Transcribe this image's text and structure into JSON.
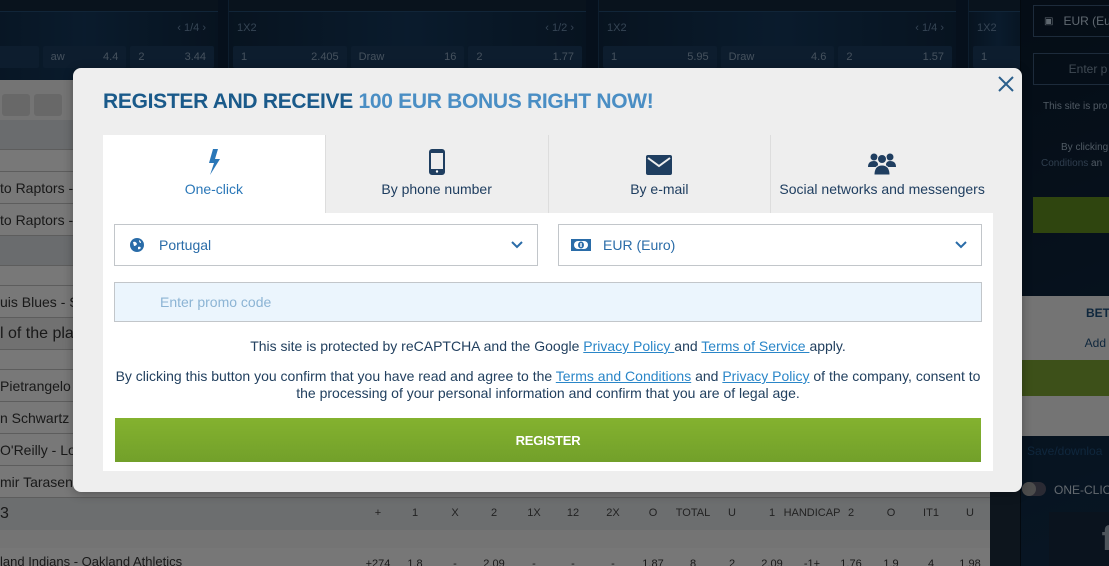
{
  "background": {
    "top_cards": [
      {
        "market": "",
        "pager": "1/4",
        "odds": [
          [
            "aw",
            "4.4"
          ],
          [
            "2",
            "3.44"
          ]
        ]
      },
      {
        "market": "1X2",
        "pager": "1/2",
        "odds": [
          [
            "1",
            "2.405"
          ],
          [
            "Draw",
            "16"
          ],
          [
            "2",
            "1.77"
          ]
        ]
      },
      {
        "market": "1X2",
        "pager": "1/4",
        "odds": [
          [
            "1",
            "5.95"
          ],
          [
            "Draw",
            "4.6"
          ],
          [
            "2",
            "1.57"
          ]
        ]
      },
      {
        "market": "1X2",
        "pager": "",
        "odds": [
          [
            "1",
            ""
          ]
        ]
      }
    ],
    "list_rows": [
      "to Raptors -",
      "to Raptors -",
      "uis Blues - S",
      "l of the pla",
      "Pietrangelo -",
      "n Schwartz -",
      "O'Reilly - Log",
      "mir Tarasenk",
      "3"
    ],
    "column_headers": [
      "+",
      "1",
      "X",
      "2",
      "1X",
      "12",
      "2X",
      "O",
      "TOTAL",
      "U",
      "1",
      "HANDICAP",
      "2",
      "O",
      "IT1",
      "U"
    ],
    "bottom_match": {
      "name": "land Indians - Oakland Athletics",
      "values": [
        "+274",
        "1.8",
        "-",
        "2.09",
        "-",
        "-",
        "-",
        "1.87",
        "8",
        "2",
        "2.09",
        "-1+",
        "1.76",
        "1.9",
        "4",
        "1.98"
      ]
    },
    "right_panel": {
      "currency": "EUR (Eu",
      "promo_placeholder": "Enter p",
      "recaptcha": "This site is pro",
      "by_clicking": "By clicking",
      "conditions": "Conditions",
      "conditions_and": " an",
      "bet_label": "BET",
      "add_label": "Add",
      "save_label": "Save/downloa",
      "one_click_label": "ONE-CLIC",
      "facebook": "f"
    }
  },
  "modal": {
    "title_main": "REGISTER AND RECEIVE ",
    "title_highlight": "100 EUR BONUS RIGHT NOW!",
    "tabs": [
      {
        "label": "One-click",
        "icon": "lightning-icon",
        "active": true
      },
      {
        "label": "By phone number",
        "icon": "phone-icon",
        "active": false
      },
      {
        "label": "By e-mail",
        "icon": "envelope-icon",
        "active": false
      },
      {
        "label": "Social networks and messengers",
        "icon": "users-icon",
        "active": false
      }
    ],
    "country": {
      "value": "Portugal",
      "icon": "globe-icon"
    },
    "currency": {
      "value": "EUR (Euro)",
      "icon": "banknote-icon"
    },
    "promo": {
      "placeholder": "Enter promo code",
      "value": ""
    },
    "recaptcha": {
      "prefix": "This site is protected by reCAPTCHA and the Google ",
      "privacy": "Privacy Policy ",
      "and": "and ",
      "terms": "Terms of Service ",
      "suffix": "apply."
    },
    "consent": {
      "prefix": "By clicking this button you confirm that you have read and agree to the ",
      "terms": "Terms and Conditions",
      "and": " and ",
      "privacy": "Privacy Policy",
      "suffix": " of the company, consent to the processing of your personal information and confirm that you are of legal age."
    },
    "register_label": "REGISTER",
    "colors": {
      "accent": "#1a5a8a",
      "highlight": "#4a8ec4",
      "button": "#7aa82c",
      "link": "#2a86c8"
    }
  }
}
